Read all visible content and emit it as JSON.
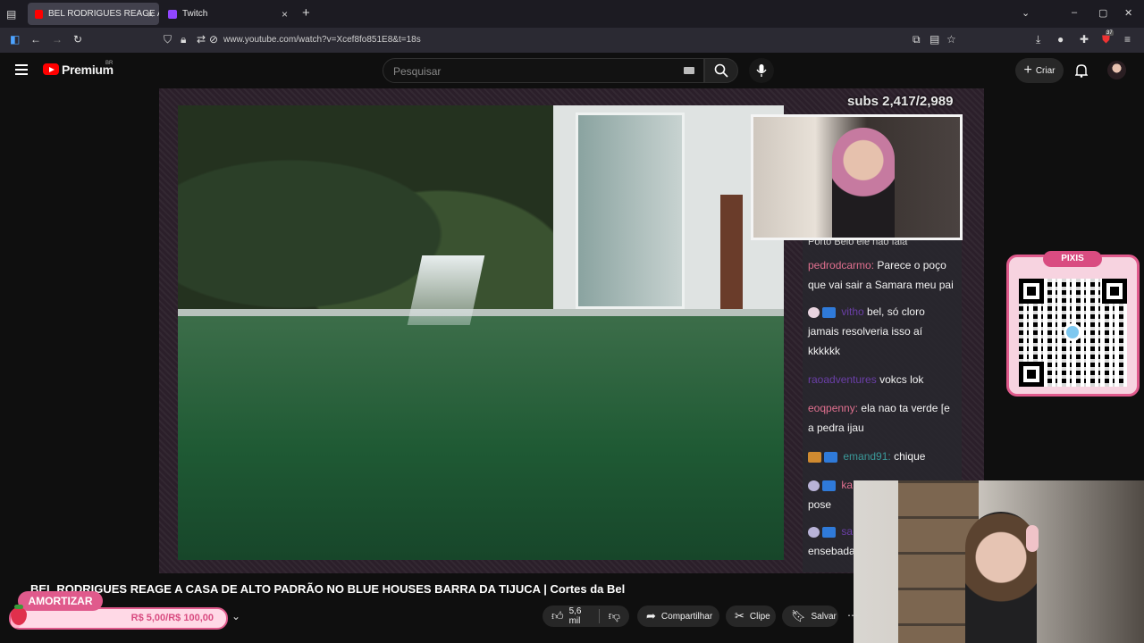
{
  "browser": {
    "tabs": [
      {
        "label": "BEL RODRIGUES REAGE A C",
        "active": true,
        "favicon_color": "#ff0000"
      },
      {
        "label": "Twitch",
        "active": false,
        "favicon_color": "#9146ff"
      }
    ],
    "url": "www.youtube.com/watch?v=Xcef8fo851E8&t=18s",
    "extension_badge": "37"
  },
  "youtube": {
    "brand": "Premium",
    "region": "BR",
    "search_placeholder": "Pesquisar",
    "create_label": "Criar"
  },
  "stream": {
    "subs": "subs 2,417/2,989",
    "chat": [
      {
        "user": "",
        "text": "Porto Belo ele não fala",
        "user_color": "#cfcfcf"
      },
      {
        "user": "pedrodcarmo:",
        "text": "Parece o poço que vai sair a Samara meu pai",
        "user_color": "#e0708f"
      },
      {
        "user": "vitho",
        "text": "bel, só cloro jamais resolveria isso aí kkkkkk",
        "user_color": "#6b3fa8"
      },
      {
        "user": "raoadventures",
        "text": "vokcs lok",
        "user_color": "#6b3fa8"
      },
      {
        "user": "eoqpenny:",
        "text": "ela nao ta verde [e a pedra ijau",
        "user_color": "#e0708f"
      },
      {
        "user": "emand91:",
        "text": "chique",
        "user_color": "#3a9a9a"
      },
      {
        "user": "ka",
        "text": "pose",
        "user_color": "#e0708f"
      },
      {
        "user": "sa",
        "text": "ensebada",
        "user_color": "#6b3fa8"
      }
    ],
    "pixis_label": "PIXIS"
  },
  "overlay": {
    "amortizar_label": "AMORTIZAR",
    "goal_value": "R$ 5,00/R$ 100,00",
    "goal_progress": 0.05
  },
  "video": {
    "title": "BEL RODRIGUES REAGE A CASA DE ALTO PADRÃO NO BLUE HOUSES BARRA DA TIJUCA | Cortes da Bel",
    "likes": "5,6 mil",
    "share_label": "Compartilhar",
    "clip_label": "Clipe",
    "save_label": "Salvar"
  }
}
